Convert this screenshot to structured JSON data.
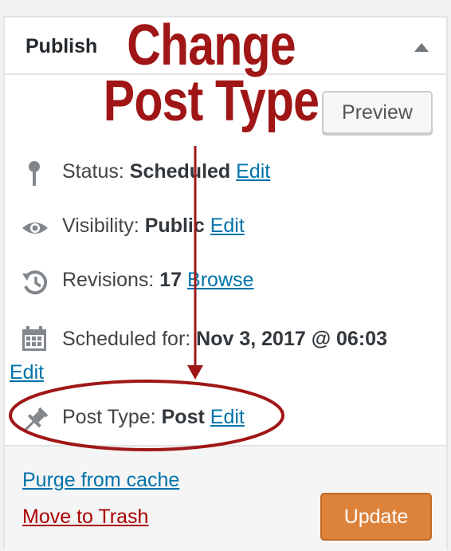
{
  "panel": {
    "title": "Publish",
    "preview_label": "Preview"
  },
  "rows": {
    "status": {
      "label": "Status:",
      "value": "Scheduled",
      "action": "Edit",
      "icon": "pin-icon"
    },
    "visibility": {
      "label": "Visibility:",
      "value": "Public",
      "action": "Edit",
      "icon": "eye-icon"
    },
    "revisions": {
      "label": "Revisions:",
      "value": "17",
      "action": "Browse",
      "icon": "history-icon"
    },
    "schedule": {
      "label": "Scheduled for:",
      "value": "Nov 3, 2017 @ 06:03",
      "action": "Edit",
      "icon": "calendar-icon"
    },
    "post_type": {
      "label": "Post Type:",
      "value": "Post",
      "action": "Edit",
      "icon": "pushpin-icon"
    }
  },
  "footer": {
    "purge_label": "Purge from cache",
    "trash_label": "Move to Trash",
    "update_label": "Update"
  },
  "annotation": {
    "line1": "Change",
    "line2": "Post Type",
    "color": "#a01616"
  },
  "colors": {
    "link": "#0073aa",
    "trash": "#aa0000",
    "update": "#dd823b"
  }
}
